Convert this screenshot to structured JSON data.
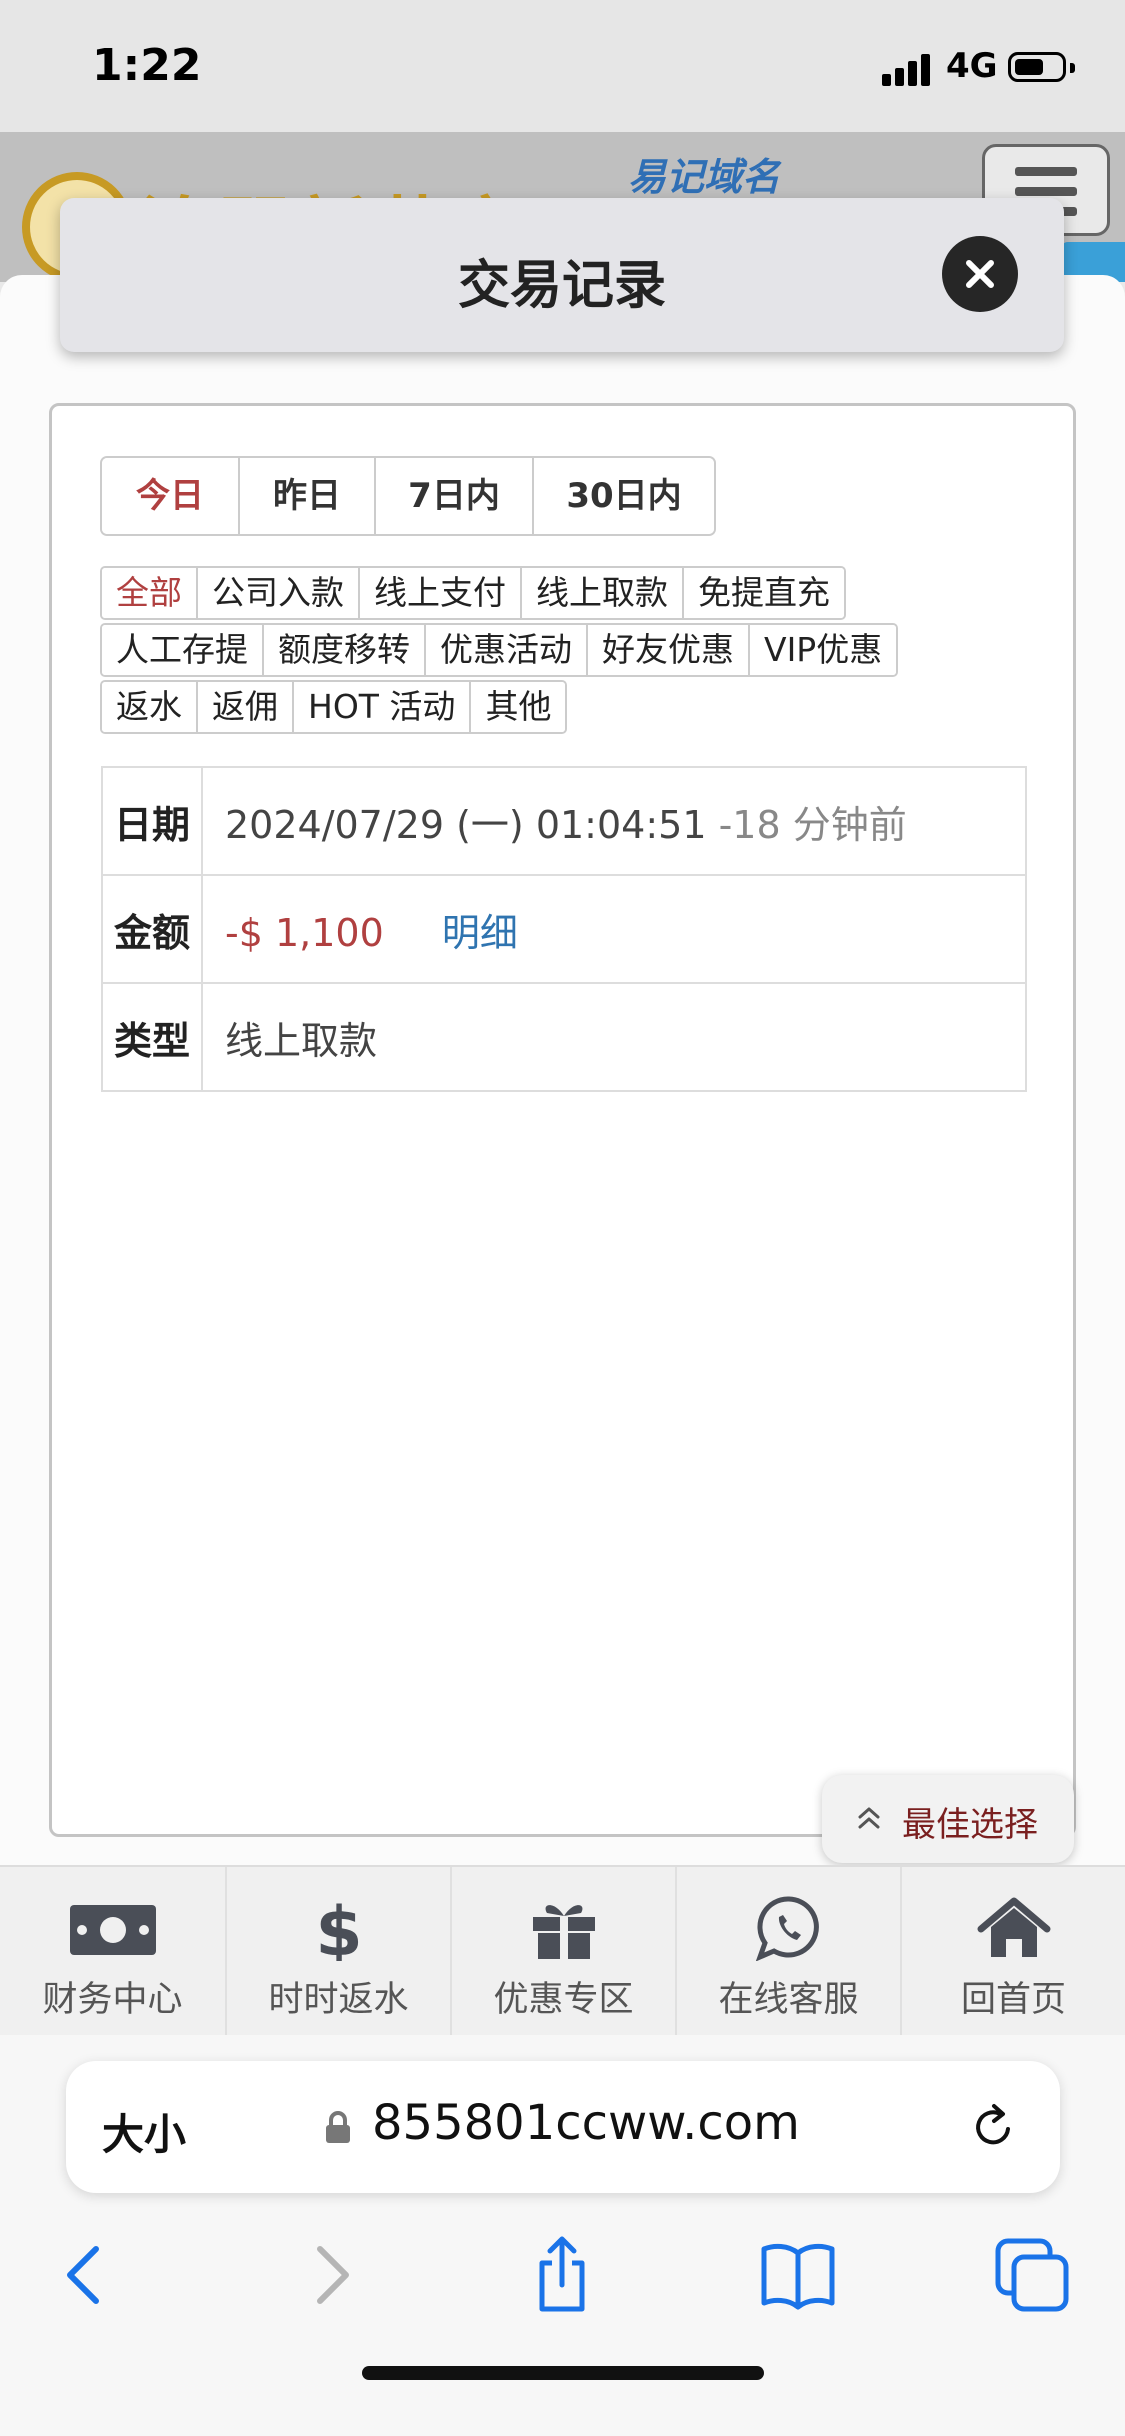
{
  "status": {
    "time": "1:22",
    "network": "4G"
  },
  "site": {
    "logo_text": "澳門新葡京",
    "domain_link": "易记域名"
  },
  "modal": {
    "title": "交易记录"
  },
  "period_tabs": [
    {
      "label": "今日",
      "active": true
    },
    {
      "label": "昨日",
      "active": false
    },
    {
      "label": "7日内",
      "active": false
    },
    {
      "label": "30日内",
      "active": false
    }
  ],
  "category_rows": [
    [
      {
        "label": "全部",
        "active": true
      },
      {
        "label": "公司入款",
        "active": false
      },
      {
        "label": "线上支付",
        "active": false
      },
      {
        "label": "线上取款",
        "active": false
      },
      {
        "label": "免提直充",
        "active": false
      }
    ],
    [
      {
        "label": "人工存提",
        "active": false
      },
      {
        "label": "额度移转",
        "active": false
      },
      {
        "label": "优惠活动",
        "active": false
      },
      {
        "label": "好友优惠",
        "active": false
      },
      {
        "label": "VIP优惠",
        "active": false
      }
    ],
    [
      {
        "label": "返水",
        "active": false
      },
      {
        "label": "返佣",
        "active": false
      },
      {
        "label": "HOT 活动",
        "active": false
      },
      {
        "label": "其他",
        "active": false
      }
    ]
  ],
  "record": {
    "date_label": "日期",
    "date_value": "2024/07/29 (一) 01:04:51",
    "date_ago": "-18 分钟前",
    "amount_label": "金额",
    "amount_value": "-$ 1,100",
    "detail_link": "明细",
    "type_label": "类型",
    "type_value": "线上取款"
  },
  "float_button": {
    "label": "最佳选择"
  },
  "bottom_nav": [
    {
      "label": "财务中心",
      "icon": "money-icon"
    },
    {
      "label": "时时返水",
      "icon": "dollar-icon"
    },
    {
      "label": "优惠专区",
      "icon": "gift-icon"
    },
    {
      "label": "在线客服",
      "icon": "whatsapp-icon"
    },
    {
      "label": "回首页",
      "icon": "home-icon"
    }
  ],
  "browser": {
    "text_size_label": "大小",
    "url": "855801ccww.com"
  },
  "colors": {
    "active_red": "#b04040",
    "link_blue": "#2f74b0",
    "safari_blue": "#1a73e8"
  }
}
